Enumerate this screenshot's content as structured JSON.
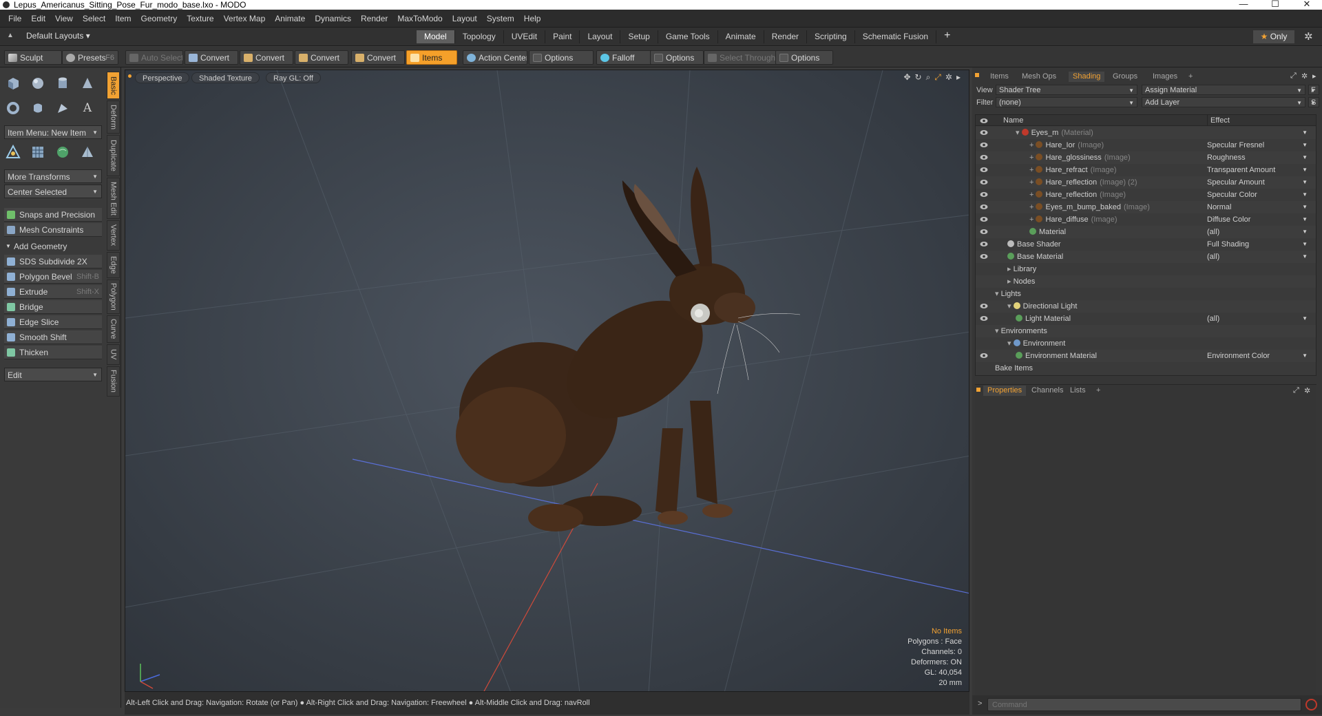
{
  "window": {
    "title": "Lepus_Americanus_Sitting_Pose_Fur_modo_base.lxo - MODO",
    "minimize": "—",
    "maximize": "☐",
    "close": "✕"
  },
  "menu": [
    "File",
    "Edit",
    "View",
    "Select",
    "Item",
    "Geometry",
    "Texture",
    "Vertex Map",
    "Animate",
    "Dynamics",
    "Render",
    "MaxToModo",
    "Layout",
    "System",
    "Help"
  ],
  "layouts": {
    "default": "Default Layouts",
    "tabs": [
      "Model",
      "Topology",
      "UVEdit",
      "Paint",
      "Layout",
      "Setup",
      "Game Tools",
      "Animate",
      "Render",
      "Scripting",
      "Schematic Fusion"
    ],
    "active_tab": "Model",
    "plus": "+",
    "only": "Only"
  },
  "toolbar": {
    "sculpt": "Sculpt",
    "presets": "Presets",
    "presets_key": "F6",
    "auto_select": "Auto Select",
    "convert1": "Convert",
    "convert2": "Convert",
    "convert3": "Convert",
    "convert4": "Convert",
    "items": "Items",
    "action_center": "Action Center",
    "options1": "Options",
    "falloff": "Falloff",
    "options2": "Options",
    "select_through": "Select Through",
    "options3": "Options"
  },
  "left": {
    "item_menu": "Item Menu: New Item",
    "more_transforms": "More Transforms",
    "center_selected": "Center Selected",
    "snaps": "Snaps and Precision",
    "constraints": "Mesh Constraints",
    "add_geometry": "Add Geometry",
    "sds": "SDS Subdivide 2X",
    "bevel": "Polygon Bevel",
    "bevel_key": "Shift-B",
    "extrude": "Extrude",
    "extrude_key": "Shift-X",
    "bridge": "Bridge",
    "edge_slice": "Edge Slice",
    "smooth_shift": "Smooth Shift",
    "thicken": "Thicken",
    "edit": "Edit",
    "vtabs": [
      "Basic",
      "Deform",
      "Duplicate",
      "Mesh Edit",
      "Vertex",
      "Edge",
      "Polygon",
      "Curve",
      "UV",
      "Fusion"
    ]
  },
  "viewport": {
    "perspective": "Perspective",
    "shaded": "Shaded Texture",
    "raygl": "Ray GL: Off",
    "info": {
      "no_items": "No Items",
      "polygons": "Polygons : Face",
      "channels": "Channels: 0",
      "deformers": "Deformers: ON",
      "gl": "GL: 40,054",
      "scale": "20 mm"
    }
  },
  "status": "Alt-Left Click and Drag: Navigation: Rotate (or Pan) ● Alt-Right Click and Drag: Navigation: Freewheel ● Alt-Middle Click and Drag: navRoll",
  "right": {
    "tabs": [
      "Items",
      "Mesh Ops",
      "Shading",
      "Groups",
      "Images"
    ],
    "active_tab": "Shading",
    "plus": "+",
    "view_label": "View",
    "view_value": "Shader Tree",
    "assign": "Assign Material",
    "assign_key": "F",
    "filter_label": "Filter",
    "filter_value": "(none)",
    "add_layer": "Add Layer",
    "add_layer_key": "S",
    "col_name": "Name",
    "col_effect": "Effect",
    "rows": [
      {
        "name": "Eyes_m",
        "type": "(Material)",
        "effect": "",
        "indent": 58,
        "eye": true,
        "dot": "#c0392b",
        "exp": "▾",
        "dd": true
      },
      {
        "name": "Hare_Ior",
        "type": "(Image)",
        "effect": "Specular Fresnel",
        "indent": 78,
        "eye": true,
        "dot": "#7a4e24",
        "exp": "+",
        "dd": true
      },
      {
        "name": "Hare_glossiness",
        "type": "(Image)",
        "effect": "Roughness",
        "indent": 78,
        "eye": true,
        "dot": "#7a4e24",
        "exp": "+",
        "dd": true
      },
      {
        "name": "Hare_refract",
        "type": "(Image)",
        "effect": "Transparent Amount",
        "indent": 78,
        "eye": true,
        "dot": "#7a4e24",
        "exp": "+",
        "dd": true
      },
      {
        "name": "Hare_reflection",
        "type": "(Image) (2)",
        "effect": "Specular Amount",
        "indent": 78,
        "eye": true,
        "dot": "#7a4e24",
        "exp": "+",
        "dd": true
      },
      {
        "name": "Hare_reflection",
        "type": "(Image)",
        "effect": "Specular Color",
        "indent": 78,
        "eye": true,
        "dot": "#7a4e24",
        "exp": "+",
        "dd": true
      },
      {
        "name": "Eyes_m_bump_baked",
        "type": "(Image)",
        "effect": "Normal",
        "indent": 78,
        "eye": true,
        "dot": "#7a4e24",
        "exp": "+",
        "dd": true
      },
      {
        "name": "Hare_diffuse",
        "type": "(Image)",
        "effect": "Diffuse Color",
        "indent": 78,
        "eye": true,
        "dot": "#7a4e24",
        "exp": "+",
        "dd": true
      },
      {
        "name": "Material",
        "type": "",
        "effect": "(all)",
        "indent": 78,
        "eye": true,
        "dot": "#5a9e5a",
        "exp": "",
        "dd": true
      },
      {
        "name": "Base Shader",
        "type": "",
        "effect": "Full Shading",
        "indent": 46,
        "eye": true,
        "dot": "#bbbbbb",
        "exp": "",
        "dd": true
      },
      {
        "name": "Base Material",
        "type": "",
        "effect": "(all)",
        "indent": 46,
        "eye": true,
        "dot": "#5a9e5a",
        "exp": "",
        "dd": true
      },
      {
        "name": "Library",
        "type": "",
        "effect": "",
        "indent": 46,
        "eye": false,
        "dot": "",
        "exp": "▸",
        "dd": false
      },
      {
        "name": "Nodes",
        "type": "",
        "effect": "",
        "indent": 46,
        "eye": false,
        "dot": "",
        "exp": "▸",
        "dd": false
      },
      {
        "name": "Lights",
        "type": "",
        "effect": "",
        "indent": 28,
        "eye": false,
        "dot": "",
        "exp": "▾",
        "dd": false
      },
      {
        "name": "Directional Light",
        "type": "",
        "effect": "",
        "indent": 46,
        "eye": true,
        "dot": "#e2d27a",
        "exp": "▾",
        "dd": false
      },
      {
        "name": "Light Material",
        "type": "",
        "effect": "(all)",
        "indent": 58,
        "eye": true,
        "dot": "#5a9e5a",
        "exp": "",
        "dd": true
      },
      {
        "name": "Environments",
        "type": "",
        "effect": "",
        "indent": 28,
        "eye": false,
        "dot": "",
        "exp": "▾",
        "dd": false
      },
      {
        "name": "Environment",
        "type": "",
        "effect": "",
        "indent": 46,
        "eye": false,
        "dot": "#6f98c9",
        "exp": "▾",
        "dd": false
      },
      {
        "name": "Environment Material",
        "type": "",
        "effect": "Environment Color",
        "indent": 58,
        "eye": true,
        "dot": "#5a9e5a",
        "exp": "",
        "dd": true
      },
      {
        "name": "Bake Items",
        "type": "",
        "effect": "",
        "indent": 28,
        "eye": false,
        "dot": "",
        "exp": "",
        "dd": false
      }
    ],
    "props_tabs": [
      "Properties",
      "Channels",
      "Lists"
    ],
    "props_active": "Properties",
    "command_placeholder": "Command"
  },
  "colors": {
    "accent": "#f2a233",
    "viewport_bg": "#3e454e"
  }
}
